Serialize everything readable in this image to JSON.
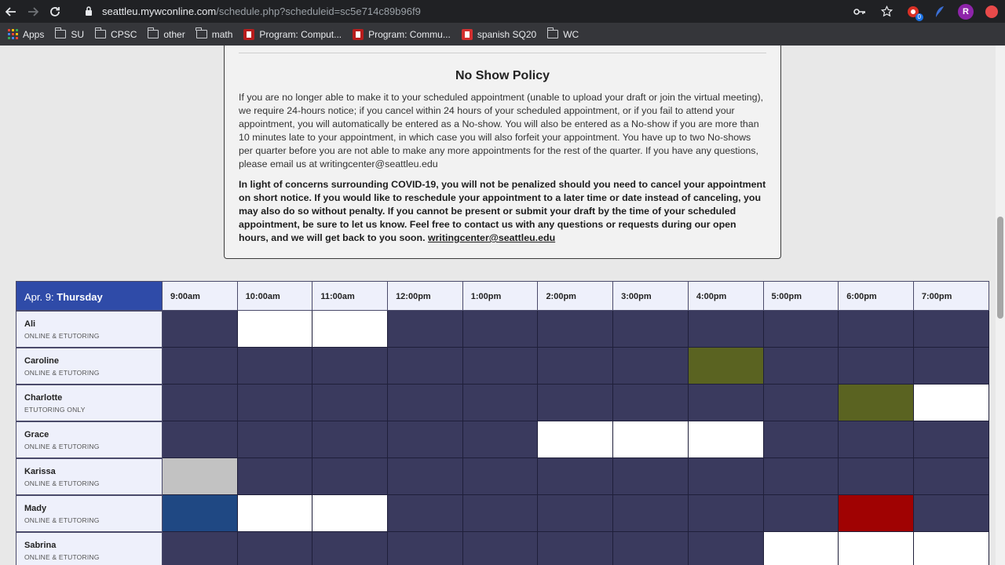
{
  "browser": {
    "url_host": "seattleu.mywconline.com",
    "url_path": "/schedule.php?scheduleid=sc5e714c89b96f9",
    "profile_initial": "R",
    "extension_badge": "0",
    "bookmarks": [
      "Apps",
      "SU",
      "CPSC",
      "other",
      "math",
      "Program: Comput...",
      "Program: Commu...",
      "spanish SQ20",
      "WC"
    ]
  },
  "policy": {
    "title": "No Show Policy",
    "paragraph": "If you are no longer able to make it to your scheduled appointment (unable to upload your draft or join the virtual meeting), we require 24-hours notice; if you cancel within 24 hours of your scheduled appointment, or if you fail to attend your appointment, you will automatically be entered as a No-show. You will also be entered as a No-show if you are more than 10 minutes late to your appointment, in which case you will also forfeit your appointment. You have up to two No-shows per quarter before you are not able to make any more appointments for the rest of the quarter. If you have any questions, please email us at writingcenter@seattleu.edu",
    "covid_text": "In light of concerns surrounding COVID-19, you will not be penalized should you need to cancel your appointment on short notice. If you would like to reschedule your appointment to a later time or date instead of canceling, you may also do so without penalty. If you cannot be present or submit your draft by the time of your scheduled appointment, be sure to let us know. Feel free to contact us with any questions or requests during our open hours, and we will get back to you soon.",
    "email_link": "writingcenter@seattleu.edu"
  },
  "schedule": {
    "date": "Apr. 9:",
    "day": "Thursday",
    "times": [
      "9:00am",
      "10:00am",
      "11:00am",
      "12:00pm",
      "1:00pm",
      "2:00pm",
      "3:00pm",
      "4:00pm",
      "5:00pm",
      "6:00pm",
      "7:00pm"
    ],
    "tutors": [
      {
        "name": "Ali",
        "mode": "ONLINE & ETUTORING",
        "slots": [
          "booked",
          "open",
          "open",
          "booked",
          "booked",
          "booked",
          "booked",
          "booked",
          "booked",
          "booked",
          "booked"
        ]
      },
      {
        "name": "Caroline",
        "mode": "ONLINE & ETUTORING",
        "slots": [
          "booked",
          "booked",
          "booked",
          "booked",
          "booked",
          "booked",
          "booked",
          "olive",
          "booked",
          "booked",
          "booked"
        ]
      },
      {
        "name": "Charlotte",
        "mode": "ETUTORING ONLY",
        "slots": [
          "booked",
          "booked",
          "booked",
          "booked",
          "booked",
          "booked",
          "booked",
          "booked",
          "booked",
          "olive",
          "open"
        ]
      },
      {
        "name": "Grace",
        "mode": "ONLINE & ETUTORING",
        "slots": [
          "booked",
          "booked",
          "booked",
          "booked",
          "booked",
          "open",
          "open",
          "open",
          "booked",
          "booked",
          "booked"
        ]
      },
      {
        "name": "Karissa",
        "mode": "ONLINE & ETUTORING",
        "slots": [
          "grey",
          "booked",
          "booked",
          "booked",
          "booked",
          "booked",
          "booked",
          "booked",
          "booked",
          "booked",
          "booked"
        ]
      },
      {
        "name": "Mady",
        "mode": "ONLINE & ETUTORING",
        "slots": [
          "blue",
          "open",
          "open",
          "booked",
          "booked",
          "booked",
          "booked",
          "booked",
          "booked",
          "red",
          "booked"
        ]
      },
      {
        "name": "Sabrina",
        "mode": "ONLINE & ETUTORING",
        "slots": [
          "booked",
          "booked",
          "booked",
          "booked",
          "booked",
          "booked",
          "booked",
          "booked",
          "open",
          "open",
          "open"
        ]
      }
    ]
  },
  "colors": {
    "booked": "#3a3a5e",
    "open": "#ffffff",
    "olive": "#5a6321",
    "grey": "#c2c2c2",
    "blue": "#1f4883",
    "red": "#a00202",
    "header_accent": "#2f4ba8"
  }
}
